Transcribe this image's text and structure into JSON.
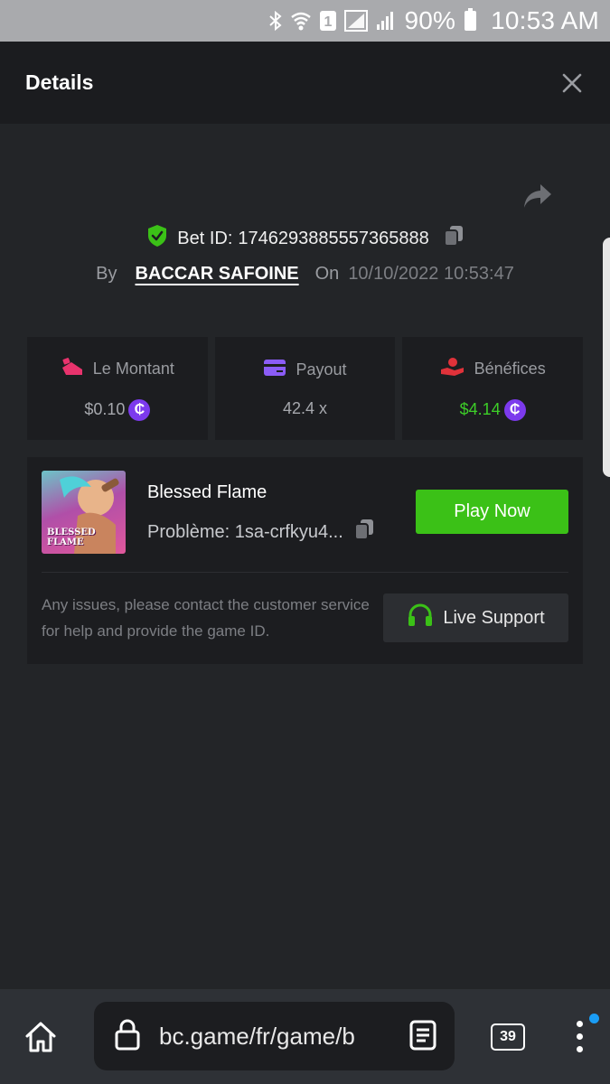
{
  "status_bar": {
    "battery_percent": "90%",
    "time": "10:53 AM",
    "sim_slot": "1",
    "icons": [
      "bluetooth-icon",
      "wifi-icon",
      "sim-icon",
      "signal-icon",
      "signal-icon",
      "battery-icon"
    ]
  },
  "header": {
    "title": "Details",
    "close_icon": "close-icon"
  },
  "bet": {
    "id_label": "Bet ID:",
    "id_value": "1746293885557365888",
    "by_label": "By",
    "user": "BACCAR SAFOINE",
    "on_label": "On",
    "datetime": "10/10/2022 10:53:47"
  },
  "stats": {
    "amount_label": "Le Montant",
    "amount_value": "$0.10",
    "payout_label": "Payout",
    "payout_value": "42.4 x",
    "profit_label": "Bénéfices",
    "profit_value": "$4.14",
    "coin_symbol": "₵"
  },
  "game": {
    "name": "Blessed Flame",
    "issue": "Problème: 1sa-crfkyu4...",
    "thumb_line1": "BLESSED",
    "thumb_line2": "FLAME",
    "play_label": "Play Now",
    "help_text": "Any issues, please contact the customer service for help and provide the game ID.",
    "support_label": "Live Support"
  },
  "browser": {
    "url": "bc.game/fr/game/b",
    "tab_count": "39"
  },
  "colors": {
    "accent_green": "#3bc117",
    "profit_green": "#3dce28",
    "coin_purple": "#7c3aed",
    "pink_icon": "#e8336d",
    "payout_icon": "#8b5cf6",
    "profit_icon": "#e0323a"
  }
}
